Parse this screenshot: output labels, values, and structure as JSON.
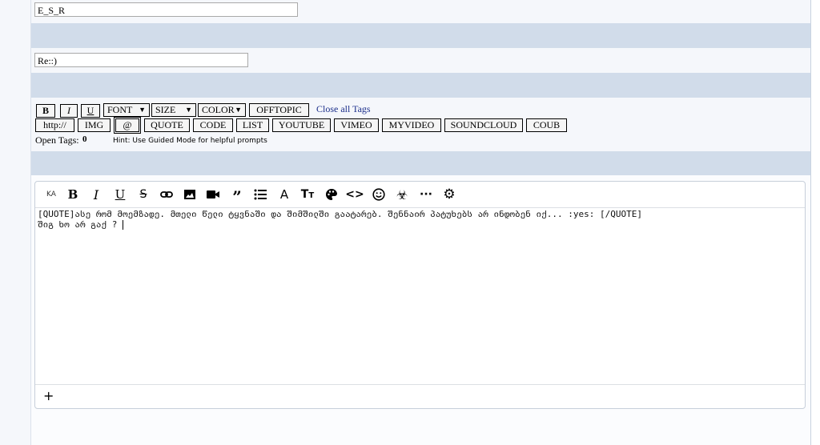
{
  "username": "E_S_R",
  "subject": "Re::)",
  "bbcode": {
    "row1": [
      {
        "id": "bold",
        "label": "B"
      },
      {
        "id": "italic",
        "label": "I"
      },
      {
        "id": "underline",
        "label": "U"
      },
      {
        "id": "font",
        "label": "FONT"
      },
      {
        "id": "size",
        "label": "SIZE"
      },
      {
        "id": "color",
        "label": "COLOR"
      },
      {
        "id": "offtopic",
        "label": "OFFTOPIC"
      }
    ],
    "close_all": "Close all Tags",
    "row2": [
      {
        "id": "http",
        "label": "http://"
      },
      {
        "id": "img",
        "label": "IMG"
      },
      {
        "id": "at",
        "label": "@"
      },
      {
        "id": "quote",
        "label": "QUOTE"
      },
      {
        "id": "code",
        "label": "CODE"
      },
      {
        "id": "list",
        "label": "LIST"
      },
      {
        "id": "youtube",
        "label": "YOUTUBE"
      },
      {
        "id": "vimeo",
        "label": "VIMEO"
      },
      {
        "id": "myvideo",
        "label": "MYVIDEO"
      },
      {
        "id": "soundcloud",
        "label": "SOUNDCLOUD"
      },
      {
        "id": "coub",
        "label": "COUB"
      }
    ],
    "open_tags_label": "Open Tags:",
    "open_tags_count": "0",
    "hint": "Hint: Use Guided Mode for helpful prompts"
  },
  "editor": {
    "toolbar": [
      {
        "name": "language-ka",
        "label": "KA"
      },
      {
        "name": "bold-icon"
      },
      {
        "name": "italic-icon"
      },
      {
        "name": "underline-icon"
      },
      {
        "name": "strikethrough-icon"
      },
      {
        "name": "link-icon"
      },
      {
        "name": "image-icon"
      },
      {
        "name": "video-icon"
      },
      {
        "name": "quote-icon"
      },
      {
        "name": "list-icon"
      },
      {
        "name": "font-icon"
      },
      {
        "name": "text-size-icon"
      },
      {
        "name": "palette-icon"
      },
      {
        "name": "code-icon"
      },
      {
        "name": "smiley-icon"
      },
      {
        "name": "biohazard-icon"
      },
      {
        "name": "more-icon"
      },
      {
        "name": "settings-icon"
      }
    ],
    "line1": "[QUOTE]ასე რომ მოემზადე. მთელი წელი ტყვნაში და შიმშილში გაატარებ. შენნაირ პატუხებს არ ინდობენ იქ... :yes: [/QUOTE]",
    "line2": "შიგ ხო არ გაქ ?",
    "footer_plus": "+"
  }
}
